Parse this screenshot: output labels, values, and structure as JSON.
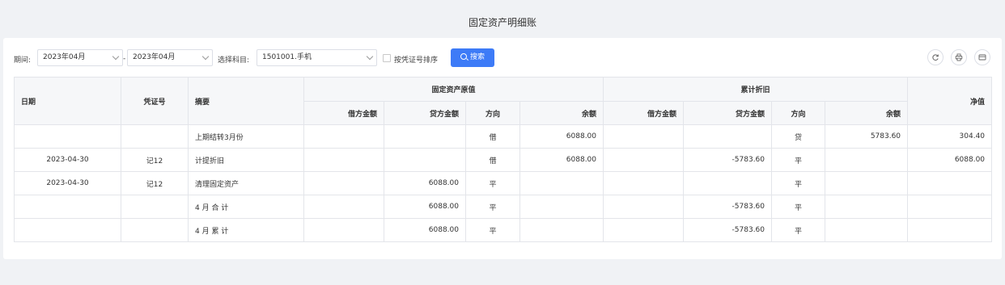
{
  "page_title": "固定资产明细账",
  "toolbar": {
    "period_label": "期间:",
    "period_start": "2023年04月",
    "period_end": "2023年04月",
    "period_separator": "-",
    "subject_label": "选择科目:",
    "subject_value": "1501001.手机",
    "sort_checkbox_label": "按凭证号排序",
    "sort_checked": false,
    "search_button": "搜索"
  },
  "table": {
    "headers": {
      "date": "日期",
      "voucher": "凭证号",
      "summary": "摘要",
      "group_original": "固定资产原值",
      "group_depreciation": "累计折旧",
      "net": "净值",
      "debit": "借方金额",
      "credit": "贷方金额",
      "direction": "方向",
      "balance": "余额"
    },
    "rows": [
      {
        "date": "",
        "voucher": "",
        "summary": "上期结转3月份",
        "o_debit": "",
        "o_credit": "",
        "o_dir": "借",
        "o_bal": "6088.00",
        "d_debit": "",
        "d_credit": "",
        "d_dir": "贷",
        "d_bal": "5783.60",
        "net": "304.40"
      },
      {
        "date": "2023-04-30",
        "voucher": "记12",
        "summary": "计提折旧",
        "o_debit": "",
        "o_credit": "",
        "o_dir": "借",
        "o_bal": "6088.00",
        "d_debit": "",
        "d_credit": "-5783.60",
        "d_dir": "平",
        "d_bal": "",
        "net": "6088.00"
      },
      {
        "date": "2023-04-30",
        "voucher": "记12",
        "summary": "清理固定资产",
        "o_debit": "",
        "o_credit": "6088.00",
        "o_dir": "平",
        "o_bal": "",
        "d_debit": "",
        "d_credit": "",
        "d_dir": "平",
        "d_bal": "",
        "net": ""
      },
      {
        "date": "",
        "voucher": "",
        "summary": "4 月 合 计",
        "o_debit": "",
        "o_credit": "6088.00",
        "o_dir": "平",
        "o_bal": "",
        "d_debit": "",
        "d_credit": "-5783.60",
        "d_dir": "平",
        "d_bal": "",
        "net": ""
      },
      {
        "date": "",
        "voucher": "",
        "summary": "4 月 累 计",
        "o_debit": "",
        "o_credit": "6088.00",
        "o_dir": "平",
        "o_bal": "",
        "d_debit": "",
        "d_credit": "-5783.60",
        "d_dir": "平",
        "d_bal": "",
        "net": ""
      }
    ]
  },
  "icons": {
    "refresh": "refresh-icon",
    "print": "printer-icon",
    "export": "card-icon"
  },
  "colors": {
    "accent": "#3d7bf7",
    "header_bg": "#f6f7f9",
    "border": "#e3e5ea"
  }
}
